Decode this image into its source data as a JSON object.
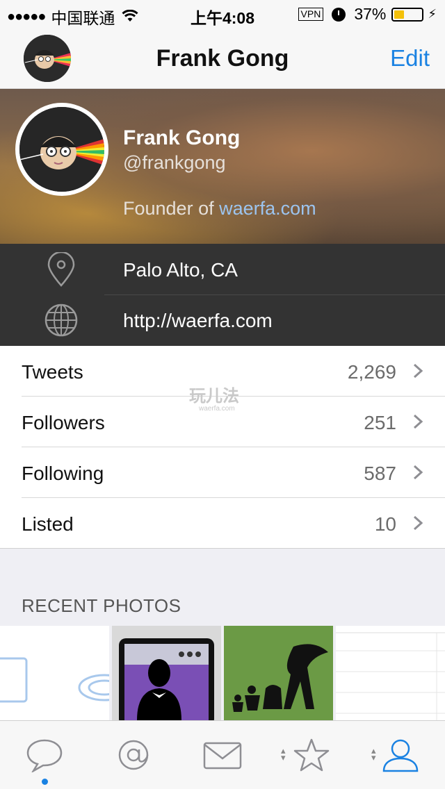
{
  "status_bar": {
    "signal": "●●●●●",
    "carrier": "中国联通",
    "time": "上午4:08",
    "vpn": "VPN",
    "battery": "37%",
    "battery_level": 0.37
  },
  "nav": {
    "title": "Frank Gong",
    "edit_label": "Edit"
  },
  "profile": {
    "name": "Frank Gong",
    "handle": "@frankgong",
    "bio_prefix": "Founder of ",
    "bio_link": "waerfa.com",
    "location": "Palo Alto, CA",
    "website": "http://waerfa.com"
  },
  "stats": [
    {
      "label": "Tweets",
      "count": "2,269"
    },
    {
      "label": "Followers",
      "count": "251"
    },
    {
      "label": "Following",
      "count": "587"
    },
    {
      "label": "Listed",
      "count": "10"
    }
  ],
  "watermark": {
    "main": "玩儿法",
    "sub": "waerfa.com"
  },
  "recent_photos": {
    "title": "RECENT PHOTOS"
  },
  "tabs": [
    {
      "name": "timeline",
      "icon": "speech-bubble-icon",
      "active": true
    },
    {
      "name": "mentions",
      "icon": "at-icon"
    },
    {
      "name": "messages",
      "icon": "envelope-icon"
    },
    {
      "name": "favorites",
      "icon": "star-icon"
    },
    {
      "name": "profile",
      "icon": "person-icon",
      "selected": true
    }
  ],
  "colors": {
    "accent": "#1a82e2",
    "battery": "#f4c10a",
    "info_bg": "#333333",
    "link": "#9cc4ef"
  }
}
